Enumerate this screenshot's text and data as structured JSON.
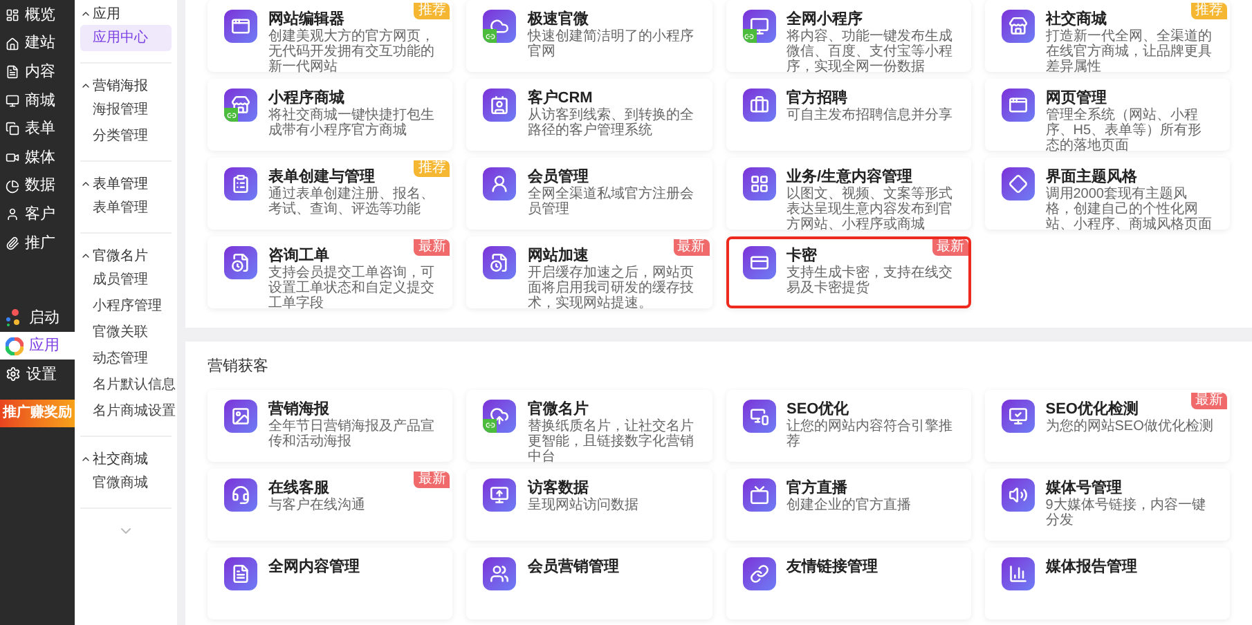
{
  "rail": {
    "top": [
      {
        "label": "概览",
        "selected": false
      },
      {
        "label": "建站",
        "selected": false
      },
      {
        "label": "内容",
        "selected": false
      },
      {
        "label": "商城",
        "selected": false
      },
      {
        "label": "表单",
        "selected": false
      },
      {
        "label": "媒体",
        "selected": false
      },
      {
        "label": "数据",
        "selected": false
      },
      {
        "label": "客户",
        "selected": false
      },
      {
        "label": "推广",
        "selected": false
      }
    ],
    "bottom": [
      {
        "label": "启动",
        "selected": false
      },
      {
        "label": "应用",
        "selected": true
      },
      {
        "label": "设置",
        "selected": false
      }
    ],
    "promo": "推广赚奖励"
  },
  "submenu": {
    "groups": [
      {
        "title": "应用",
        "expanded": true,
        "items": [
          {
            "label": "应用中心",
            "selected": true
          }
        ]
      },
      {
        "title": "营销海报",
        "expanded": true,
        "items": [
          {
            "label": "海报管理",
            "selected": false
          },
          {
            "label": "分类管理",
            "selected": false
          }
        ]
      },
      {
        "title": "表单管理",
        "expanded": true,
        "items": [
          {
            "label": "表单管理",
            "selected": false
          }
        ]
      },
      {
        "title": "官微名片",
        "expanded": true,
        "items": [
          {
            "label": "成员管理",
            "selected": false
          },
          {
            "label": "小程序管理",
            "selected": false
          },
          {
            "label": "官微关联",
            "selected": false
          },
          {
            "label": "动态管理",
            "selected": false
          },
          {
            "label": "名片默认信息",
            "selected": false
          },
          {
            "label": "名片商城设置",
            "selected": false
          }
        ]
      },
      {
        "title": "社交商城",
        "expanded": true,
        "items": [
          {
            "label": "官微商城",
            "selected": false
          }
        ]
      }
    ]
  },
  "sections": [
    {
      "cards": [
        {
          "title": "网站编辑器",
          "description": "创建美观大方的官方网页，无代码开发拥有交互功能的新一代网站",
          "badge": {
            "kind": "recommend",
            "label": "推荐"
          },
          "linked": false,
          "highlighted": false
        },
        {
          "title": "极速官微",
          "description": "快速创建简洁明了的小程序官网",
          "linked": true,
          "highlighted": false
        },
        {
          "title": "全网小程序",
          "description": "将内容、功能一键发布生成微信、百度、支付宝等小程序，实现全网一份数据",
          "linked": true,
          "highlighted": false
        },
        {
          "title": "社交商城",
          "description": "打造新一代全网、全渠道的在线官方商城，让品牌更具差异属性",
          "badge": {
            "kind": "recommend",
            "label": "推荐"
          },
          "linked": false,
          "highlighted": false
        },
        {
          "title": "小程序商城",
          "description": "将社交商城一键快捷打包生成带有小程序官方商城",
          "linked": true,
          "highlighted": false
        },
        {
          "title": "客户CRM",
          "description": "从访客到线索、到转换的全路径的客户管理系统",
          "linked": false,
          "highlighted": false
        },
        {
          "title": "官方招聘",
          "description": "可自主发布招聘信息并分享",
          "linked": false,
          "highlighted": false
        },
        {
          "title": "网页管理",
          "description": "管理全系统（网站、小程序、H5、表单等）所有形态的落地页面",
          "linked": false,
          "highlighted": false
        },
        {
          "title": "表单创建与管理",
          "description": "通过表单创建注册、报名、考试、查询、评选等功能",
          "badge": {
            "kind": "recommend",
            "label": "推荐"
          },
          "linked": false,
          "highlighted": false
        },
        {
          "title": "会员管理",
          "description": "全网全渠道私域官方注册会员管理",
          "linked": false,
          "highlighted": false
        },
        {
          "title": "业务/生意内容管理",
          "description": "以图文、视频、文案等形式表达呈现生意内容发布到官方网站、小程序或商城",
          "linked": false,
          "highlighted": false
        },
        {
          "title": "界面主题风格",
          "description": "调用2000套现有主题风格，创建自己的个性化网站、小程序、商城风格页面",
          "linked": false,
          "highlighted": false
        },
        {
          "title": "咨询工单",
          "description": "支持会员提交工单咨询，可设置工单状态和自定义提交工单字段",
          "badge": {
            "kind": "new",
            "label": "最新"
          },
          "linked": false,
          "highlighted": false
        },
        {
          "title": "网站加速",
          "description": "开启缓存加速之后，网站页面将启用我司研发的缓存技术，实现网站提速。",
          "badge": {
            "kind": "new",
            "label": "最新"
          },
          "linked": false,
          "highlighted": false
        },
        {
          "title": "卡密",
          "description": "支持生成卡密，支持在线交易及卡密提货",
          "badge": {
            "kind": "new",
            "label": "最新"
          },
          "linked": false,
          "highlighted": true
        }
      ]
    },
    {
      "title": "营销获客",
      "cards": [
        {
          "title": "营销海报",
          "description": "全年节日营销海报及产品宣传和活动海报",
          "linked": false,
          "highlighted": false
        },
        {
          "title": "官微名片",
          "description": "替换纸质名片，让社交名片更智能，且链接数字化营销中台",
          "linked": true,
          "highlighted": false
        },
        {
          "title": "SEO优化",
          "description": "让您的网站内容符合引擎推荐",
          "linked": false,
          "highlighted": false
        },
        {
          "title": "SEO优化检测",
          "description": "为您的网站SEO做优化检测",
          "badge": {
            "kind": "new",
            "label": "最新"
          },
          "linked": false,
          "highlighted": false
        },
        {
          "title": "在线客服",
          "description": "与客户在线沟通",
          "badge": {
            "kind": "new",
            "label": "最新"
          },
          "linked": false,
          "highlighted": false
        },
        {
          "title": "访客数据",
          "description": "呈现网站访问数据",
          "linked": false,
          "highlighted": false
        },
        {
          "title": "官方直播",
          "description": "创建企业的官方直播",
          "linked": false,
          "highlighted": false
        },
        {
          "title": "媒体号管理",
          "description": "9大媒体号链接，内容一键分发",
          "linked": false,
          "highlighted": false
        },
        {
          "title": "全网内容管理",
          "linked": false,
          "highlighted": false
        },
        {
          "title": "会员营销管理",
          "linked": false,
          "highlighted": false
        },
        {
          "title": "友情链接管理",
          "linked": false,
          "highlighted": false
        },
        {
          "title": "媒体报告管理",
          "linked": false,
          "highlighted": false
        }
      ]
    }
  ]
}
